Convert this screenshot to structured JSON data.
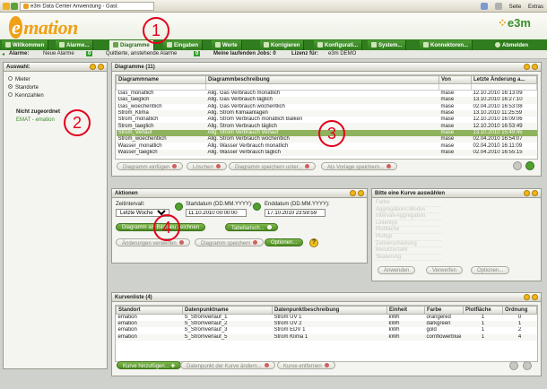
{
  "browser": {
    "tab_title": "e3m Data Center Anwendung - Gast",
    "seite": "Seite",
    "extras": "Extras"
  },
  "logo": {
    "e": "e",
    "text": "mation",
    "e3m": "e3m"
  },
  "nav": {
    "tabs": [
      {
        "label": "Willkommen"
      },
      {
        "label": "Alarme..."
      },
      {
        "label": "Diagramme"
      },
      {
        "label": "Eingaben"
      },
      {
        "label": "Werte"
      },
      {
        "label": "Korrigieren"
      },
      {
        "label": "Konfigurati..."
      },
      {
        "label": "System..."
      },
      {
        "label": "Konnektoren..."
      }
    ],
    "logout": "Abmelden"
  },
  "statusbar": {
    "alarme_label": "Alarme:",
    "neue_alarme": "Neue Alarme",
    "neue_count": "0",
    "quittierte": "Quittierte, anstehende Alarme",
    "quittierte_count": "0",
    "jobs": "Meine laufenden Jobs: 0",
    "lizenz": "Lizenz für:",
    "lizenz_value": "e3m DEMO"
  },
  "auswahl": {
    "title": "Auswahl:",
    "options": [
      "Mieter",
      "Standorte",
      "Kennzahlen"
    ],
    "selected": "Standorte",
    "tree_header": "Nicht zugeordnet",
    "tree_item": "EMAT - emation"
  },
  "diagramme": {
    "title": "Diagramme (11)",
    "columns": [
      "Diagrammname",
      "Diagrammbeschreibung",
      "Von",
      "Letzte Änderung a..."
    ],
    "rows": [
      [
        "Gas_monatlich",
        "Allg. Gas Verbrauch monatlich",
        "mase",
        "12.10.2010 16:13:09"
      ],
      [
        "Gas_taeglich",
        "Allg. Gas Verbrauch täglich",
        "mase",
        "13.10.2010 16:27:10"
      ],
      [
        "Gas_woechentlich",
        "Allg. Gas Verbrauch  wöchentlich",
        "mase",
        "02.04.2010 16:53:08"
      ],
      [
        "Strom_Klima",
        "Allg. Strom Klimaanlagen",
        "mase",
        "13.10.2010 11:25:59"
      ],
      [
        "Strom_monatlich",
        "Allg. Strom Verbrauch monatlich Balken",
        "mase",
        "12.10.2010 16:09:06"
      ],
      [
        "Strom_taeglich",
        "Allg. Strom Verbrauch täglich",
        "mase",
        "12.10.2010 16:53:49"
      ],
      [
        "Strom_Verlauf",
        "Allg. Strom Verbrauch Verlauf",
        "mase",
        "13.10.2010 15:49:45"
      ],
      [
        "Strom_woechentlich",
        "Allg. Strom Verbrauch wöchentlich",
        "mase",
        "02.04.2010 16:54:07"
      ],
      [
        "Wasser_monatlich",
        "Allg. Wasser Verbrauch monatlich",
        "mase",
        "02.04.2010 16:11:09"
      ],
      [
        "Wasser_taeglich",
        "Allg. Wasser Verbrauch täglich",
        "mase",
        "02.04.2010 16:55:15"
      ]
    ],
    "selected_row": 6,
    "buttons": {
      "einfuegen": "Diagramm einfügen",
      "loeschen": "Löschen",
      "speichern_unter": "Diagramm speichern unter...",
      "vorlage": "Als Vorlage speichern..."
    }
  },
  "aktionen": {
    "title": "Aktionen",
    "zeitintervall_label": "Zeitintervall:",
    "zeitintervall_value": "Letzte Woche",
    "start_label": "Startdatum (DD.MM.YYYY):",
    "start_value": "11.10.2010 00:00:00",
    "end_label": "Enddatum (DD.MM.YYYY):",
    "end_value": "17.10.2010 23:59:59",
    "buttons": {
      "zeichnen": "Diagramm als Bild neu zeichnen",
      "tabellarisch": "Tabellarisch...",
      "verwerfen": "Änderungen verwerfen",
      "speichern": "Diagramm speichern",
      "optionen": "Optionen..."
    },
    "help": "?"
  },
  "kurve": {
    "title": "Bitte eine Kurve auswählen",
    "items": [
      "Farbe",
      "Aggregations-Modus",
      "Intervall-Aggregation",
      "Linientyp",
      "Plotfläche",
      "Plottyp",
      "Zeitverschiebung",
      "Benutzerzahl",
      "Skalierung"
    ],
    "buttons": {
      "anwenden": "Anwenden",
      "verwerfen": "Verwerfen",
      "optionen": "Optionen..."
    }
  },
  "kurvenliste": {
    "title": "Kurvenliste (4)",
    "columns": [
      "Standort",
      "Datenpunktname",
      "Datenpunktbeschreibung",
      "Einheit",
      "Farbe",
      "Plotfläche",
      "Ordnung"
    ],
    "rows": [
      [
        "emation",
        "S_Stromverlauf_1",
        "Strom UV 1",
        "kWh",
        "orangered",
        "1",
        "0"
      ],
      [
        "emation",
        "S_Stromverlauf_2",
        "Strom UV 2",
        "kWh",
        "darkgreen",
        "1",
        "1"
      ],
      [
        "emation",
        "S_Stromverlauf_3",
        "Strom EDV 1",
        "kWh",
        "gold",
        "1",
        "2"
      ],
      [
        "emation",
        "S_Stromverlauf_5",
        "Strom Klima 1",
        "kWh",
        "cornflowerblue",
        "1",
        "4"
      ]
    ],
    "buttons": {
      "hinzufuegen": "Kurve hinzufügen...",
      "aendern": "Datenpunkt der Kurve ändern...",
      "entfernen": "Kurve entfernen"
    }
  },
  "callouts": [
    "1",
    "2",
    "3",
    "4"
  ],
  "colors": {
    "accent_green": "#2f7d1e",
    "selected_row": "#8fb25c",
    "logo_orange": "#f0a016",
    "callout_red": "#e3001b"
  }
}
